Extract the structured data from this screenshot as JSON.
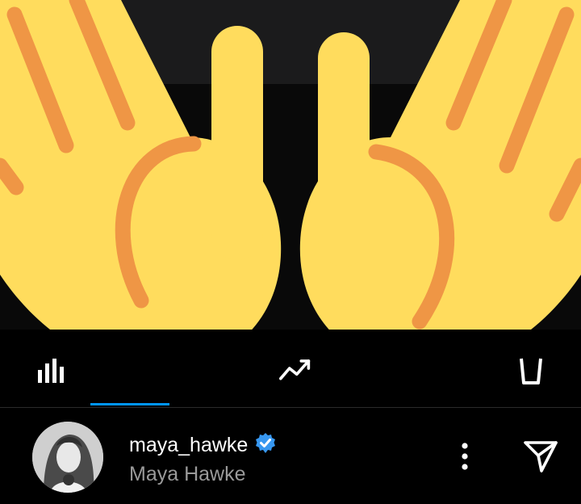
{
  "colors": {
    "background": "#000000",
    "accent": "#0095f6",
    "verified": "#3797f0",
    "emoji_skin": "#ffdc5d",
    "emoji_lines": "#ef9645"
  },
  "overlay": {
    "emoji_icon": "raised-hands-emoji"
  },
  "toolbar": {
    "items": [
      {
        "icon": "bar-chart-icon",
        "active": true
      },
      {
        "icon": "trending-up-icon",
        "active": false
      },
      {
        "icon": "trash-icon",
        "active": false
      }
    ]
  },
  "profile": {
    "username": "maya_hawke",
    "verified": true,
    "display_name": "Maya Hawke",
    "actions": [
      "more-icon",
      "send-icon"
    ]
  }
}
